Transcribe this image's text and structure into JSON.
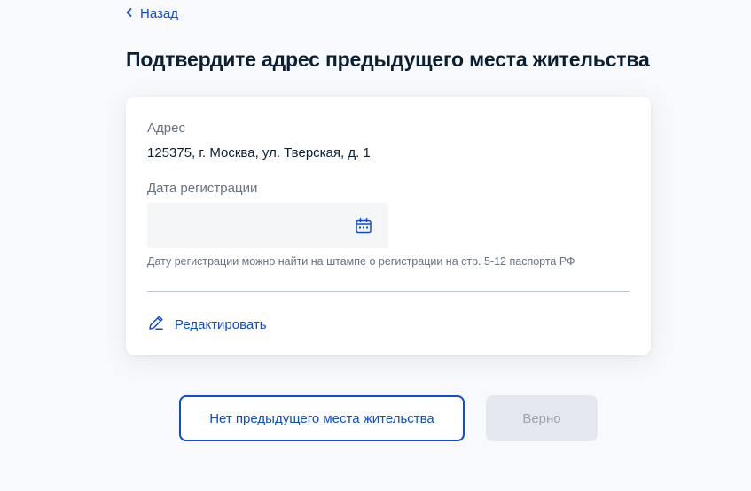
{
  "nav": {
    "back_label": "Назад"
  },
  "page": {
    "title": "Подтвердите адрес предыдущего места жительства"
  },
  "card": {
    "address_label": "Адрес",
    "address_value": "125375, г. Москва, ул. Тверская, д. 1",
    "date_label": "Дата регистрации",
    "date_value": "",
    "date_hint": "Дату регистрации можно найти на штампе о регистрации на стр. 5-12 паспорта РФ",
    "edit_label": "Редактировать"
  },
  "actions": {
    "no_previous_label": "Нет предыдущего места жительства",
    "confirm_label": "Верно"
  },
  "colors": {
    "accent": "#0d4cd3",
    "text": "#0b1f33",
    "muted": "#66727f",
    "disabled_bg": "#e4e8ee",
    "disabled_text": "#9ba3ae"
  },
  "icons": {
    "back": "chevron-left-icon",
    "calendar": "calendar-icon",
    "edit": "pencil-icon"
  }
}
